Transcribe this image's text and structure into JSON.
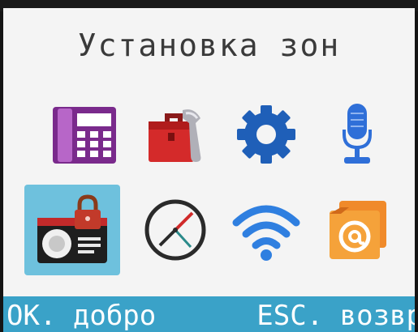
{
  "screen": {
    "title": "Установка зон",
    "icons": [
      {
        "name": "telephone-icon",
        "selected": false
      },
      {
        "name": "toolbox-icon",
        "selected": false
      },
      {
        "name": "gear-icon",
        "selected": false
      },
      {
        "name": "microphone-icon",
        "selected": false
      },
      {
        "name": "radio-lock-icon",
        "selected": true
      },
      {
        "name": "clock-icon",
        "selected": false
      },
      {
        "name": "wifi-icon",
        "selected": false
      },
      {
        "name": "email-icon",
        "selected": false
      }
    ],
    "selected_index": 4
  },
  "softkeys": {
    "left_label": "OK. добро",
    "right_label": "ESC. возвр"
  },
  "colors": {
    "selection": "#6ec1dd",
    "softkey_bar": "#3aa2c8",
    "background": "#f4f4f4"
  }
}
